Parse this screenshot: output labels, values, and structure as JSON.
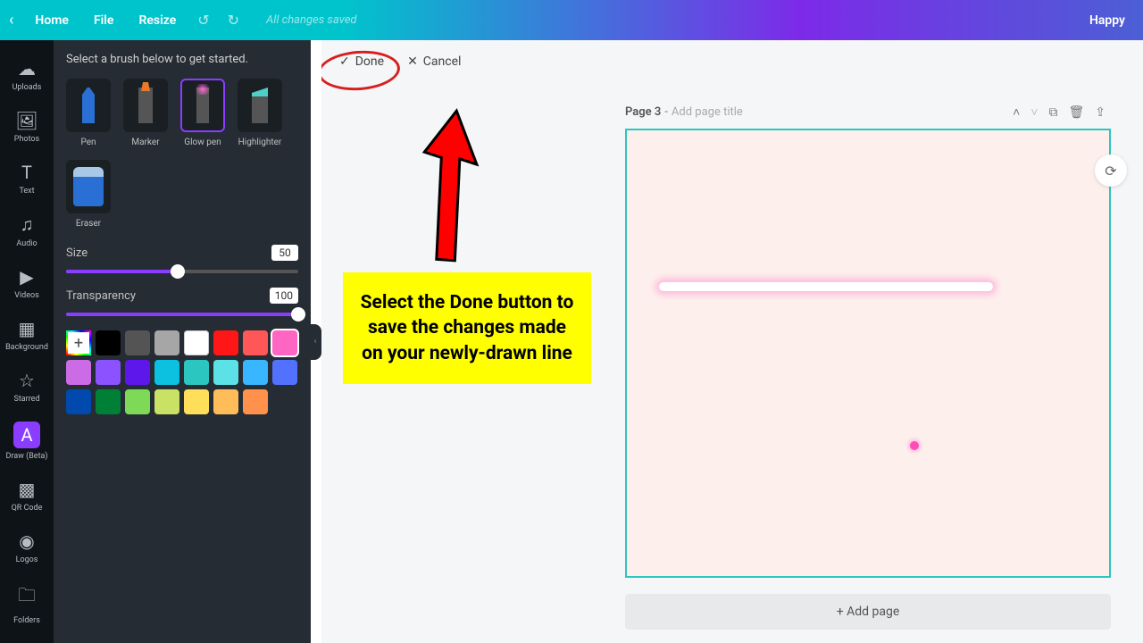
{
  "topbar": {
    "home": "Home",
    "file": "File",
    "resize": "Resize",
    "saved": "All changes saved",
    "user": "Happy"
  },
  "nav": {
    "uploads": "Uploads",
    "photos": "Photos",
    "text": "Text",
    "audio": "Audio",
    "videos": "Videos",
    "background": "Background",
    "starred": "Starred",
    "draw": "Draw (Beta)",
    "qrcode": "QR Code",
    "logos": "Logos",
    "folders": "Folders"
  },
  "panel": {
    "hint": "Select a brush below to get started.",
    "brushes": {
      "pen": "Pen",
      "marker": "Marker",
      "glow": "Glow pen",
      "highlighter": "Highlighter",
      "eraser": "Eraser"
    },
    "size_label": "Size",
    "size_value": "50",
    "size_pct": 48,
    "transparency_label": "Transparency",
    "transparency_value": "100",
    "transparency_pct": 100,
    "colors": [
      "picker",
      "#000000",
      "#545454",
      "#a6a6a6",
      "#ffffff",
      "#ff1616",
      "#ff5757",
      "#ff66c4",
      "#cb6ce6",
      "#8c52ff",
      "#5e17eb",
      "#0cc0df",
      "#2cc6c0",
      "#5ce1e6",
      "#38b6ff",
      "#5271ff",
      "#004aad",
      "#008037",
      "#7ed957",
      "#c9e265",
      "#ffde59",
      "#ffbd59",
      "#ff914d"
    ],
    "selected_color_index": 7
  },
  "editbar": {
    "done": "Done",
    "cancel": "Cancel"
  },
  "callout": "Select the Done button to save the changes made on your newly-drawn line",
  "page": {
    "label": "Page 3",
    "title_placeholder": "Add page title",
    "add_page": "+ Add page"
  }
}
